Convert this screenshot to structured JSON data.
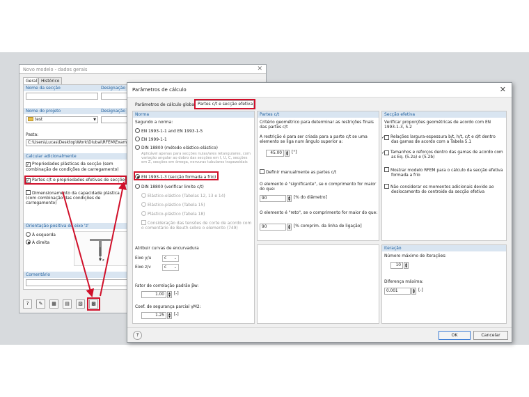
{
  "dialog1": {
    "title": "Novo modelo - dados gerais",
    "tabs": [
      "Geral",
      "Histórico"
    ],
    "nome_seccao_label": "Nome da secção",
    "designacao_label": "Designação",
    "nome_projeto_label": "Nome do projeto",
    "designacao_label2": "Designação",
    "project_value": "test",
    "pasta_label": "Pasta:",
    "pasta_value": "C:\\Users\\Lucas\\Desktop\\Work\\Dlubal\\RFEM\\Examp",
    "calc_header": "Calcular adicionalmente",
    "cb1_label": "Propriedades plásticas da secção (sem combinação de condições de carregamento)",
    "cb2_label": "Partes c/t e propriedades efetivas de secções",
    "cb3_label": "Dimensionamento da capacidade plástica (com combinação das condições de carregamento)",
    "orient_header": "Orientação positiva do eixo 'z'",
    "orient_left": "À esquerda",
    "orient_right": "À direita",
    "axis_label": "z",
    "comment_header": "Comentário"
  },
  "dialog2": {
    "title": "Parâmetros de cálculo",
    "tabs": [
      "Parâmetros de cálculo globais",
      "Partes c/t e secção efetiva"
    ],
    "norma": {
      "header": "Norma",
      "segundo": "Segundo a norma:",
      "opt1": "EN 1993-1-1 and EN 1993-1-5",
      "opt2": "EN 1999-1-1",
      "opt3": "DIN 18800 (método elástico-elástico)",
      "opt3_note": "Aplicável apenas para secções nulas/ares retangulares, com variação angular ao dobro das secções em I, U, C, secções em Z, secções em ômega, nervuras tubulares trapezoidais",
      "opt4": "EN 1993-1-3 (secção formada a frio)",
      "opt5": "DIN 18800 (verificar limite c/t)",
      "sub1": "Elástico-elástico (Tabelas 12, 13 e 14)",
      "sub2": "Elástico-plástico (Tabela 15)",
      "sub3": "Plástico-plástico (Tabela 18)",
      "sub4": "Consideração das tensões de corte de acordo com o comentário de Beuth sobre o elemento (749)",
      "curvas_label": "Atribuir curvas de encurvadura",
      "eixo_yu": "Eixo y/u",
      "eixo_zv": "Eixo z/v",
      "curve_y": "c",
      "curve_z": "c",
      "fator_label": "Fator de correlação padrão βw:",
      "fator_value": "1.00",
      "fator_unit": "[-]",
      "coef_label": "Coef. de segurança parcial γM2:",
      "coef_value": "1.25",
      "coef_unit": "[-]"
    },
    "partes": {
      "header": "Partes c/t",
      "criterio": "Critério geométrico para determinar as restrições finais das partes c/t",
      "restricao": "A restrição é para ser criada para a parte c/t se uma elemento se liga num ângulo superior a:",
      "angle_value": "45.00",
      "angle_unit": "[°]",
      "definir": "Definir manualmente as partes c/t",
      "significante": "O elemento é \"significante\", se o comprimento for maior do que:",
      "sig_value": "90",
      "sig_unit": "[% do diâmetro]",
      "reto": "O elemento é \"reto\", se o comprimento for maior do que:",
      "reto_value": "90",
      "reto_unit": "[% comprim. da linha de ligação]"
    },
    "seccao": {
      "header": "Secção efetiva",
      "verificar": "Verificar proporções geométricas de acordo com EN 1993-1-3, 5.2",
      "cb1": "Relações largura-espessura b/t, h/t, c/t e d/t dentro das gamas de acordo com a Tabela 5.1",
      "cb2": "Tamanhos e reforços dentro das gamas de acordo com as Eq. (5.2a) e (5.2b)",
      "cb3": "Mostrar modelo RFEM para o cálculo da secção efetiva formada a frio",
      "cb4": "Não considerar os momentos adicionais devido ao deslocamento do centroide da secção efetiva"
    },
    "iteracao": {
      "header": "Iteração",
      "max_label": "Número máximo de iterações:",
      "max_value": "10",
      "dif_label": "Diferença máxima:",
      "dif_value": "0.001",
      "dif_unit": "[-]"
    },
    "ok": "OK",
    "cancel": "Cancelar"
  },
  "colors": {
    "accent": "#d0102a",
    "section_header": "#d9e5f1"
  }
}
